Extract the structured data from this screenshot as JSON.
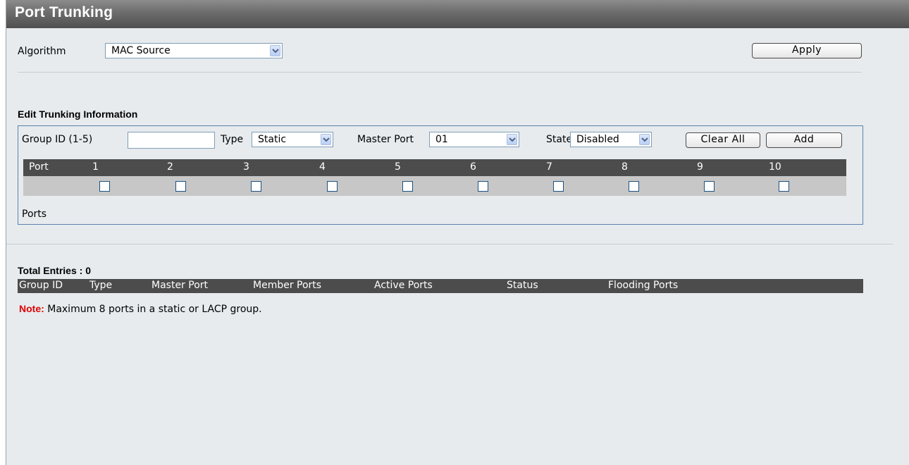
{
  "page": {
    "title": "Port Trunking"
  },
  "algorithm": {
    "label": "Algorithm",
    "value": "MAC Source",
    "apply_label": "Apply"
  },
  "edit": {
    "heading": "Edit Trunking Information",
    "group_id_label": "Group ID (1-5)",
    "group_id_value": "",
    "type_label": "Type",
    "type_value": "Static",
    "master_port_label": "Master Port",
    "master_port_value": "01",
    "state_label": "State",
    "state_value": "Disabled",
    "clear_all_label": "Clear All",
    "add_label": "Add",
    "port_header_label": "Port",
    "ports": [
      "1",
      "2",
      "3",
      "4",
      "5",
      "6",
      "7",
      "8",
      "9",
      "10"
    ],
    "ports_label": "Ports"
  },
  "table": {
    "total_entries": "Total Entries : 0",
    "columns": [
      "Group ID",
      "Type",
      "Master Port",
      "Member Ports",
      "Active Ports",
      "Status",
      "Flooding Ports"
    ]
  },
  "note": {
    "label": "Note:",
    "text": "Maximum 8 ports in a static or LACP group.",
    "color": "#e00000"
  },
  "colors": {
    "header_bar": "#4c4c4c",
    "checkbox_row": "#c7c7c7",
    "page_bg": "#e7ebee",
    "box_border": "#5b82ac"
  }
}
